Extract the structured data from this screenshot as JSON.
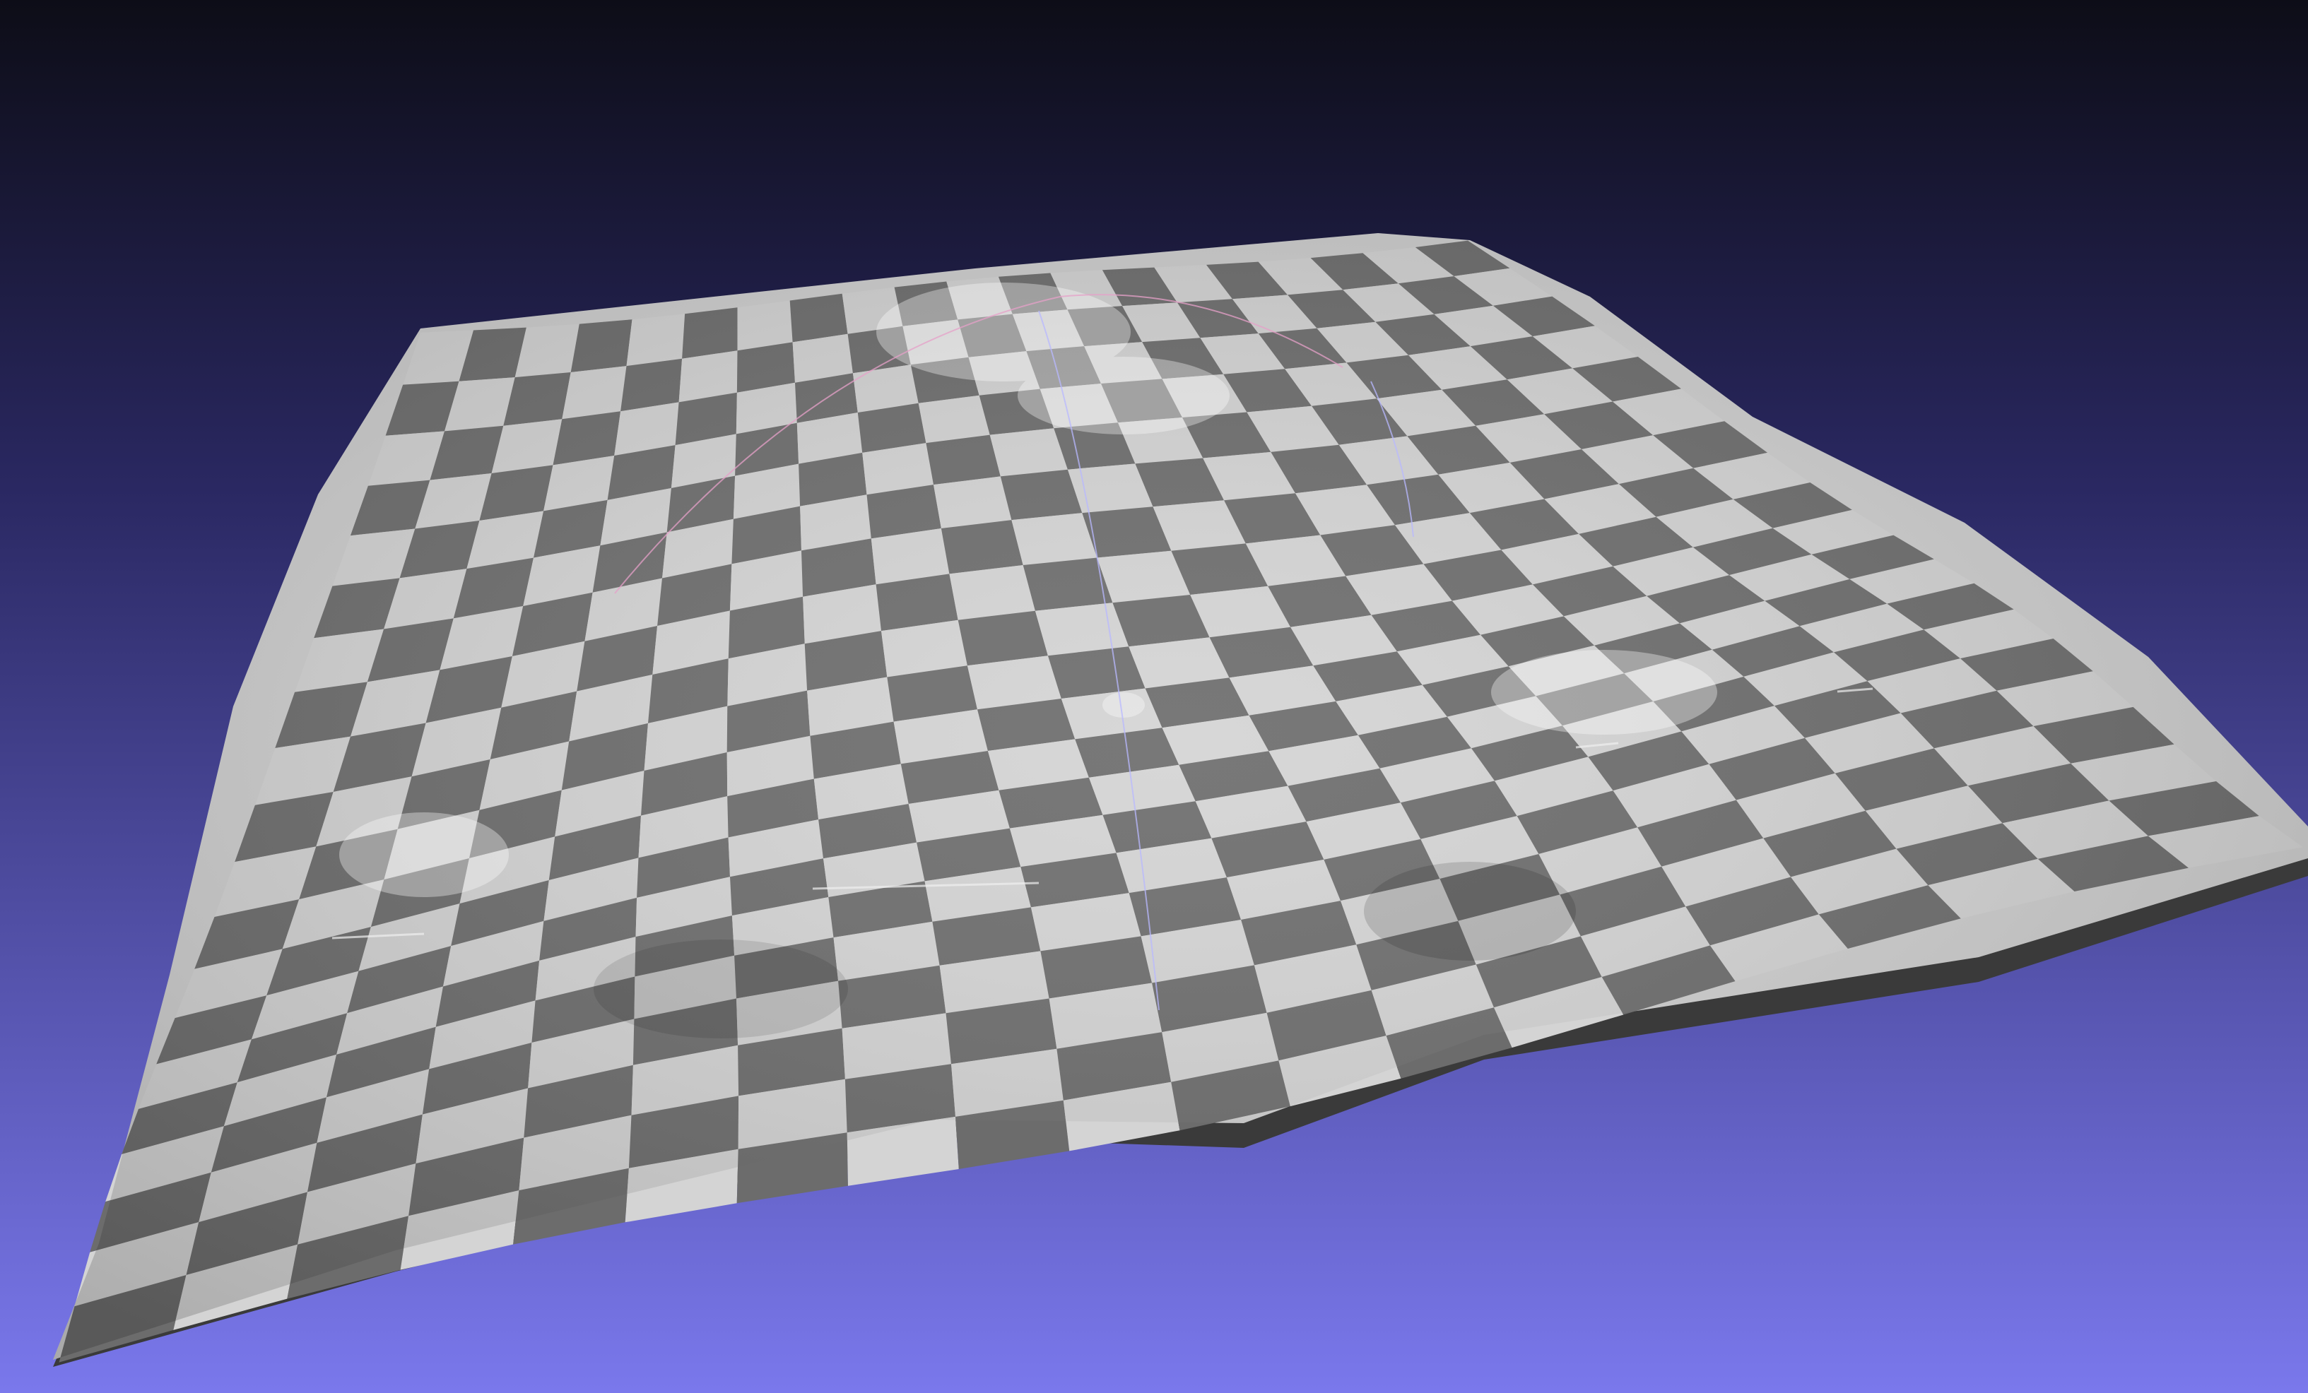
{
  "viewer": {
    "background_top": "#0d0d17",
    "background_mid": "#2a2862",
    "background_bottom": "#7a78ec",
    "checker_light": "#d4d4d4",
    "checker_dark": "#6c6c6c",
    "mesh_edge": "#cfcfcf",
    "mesh_underside": "#3a3a3a",
    "overlay_arc_color": "#e6a0c8",
    "overlay_line_color": "#b8b8ff"
  }
}
